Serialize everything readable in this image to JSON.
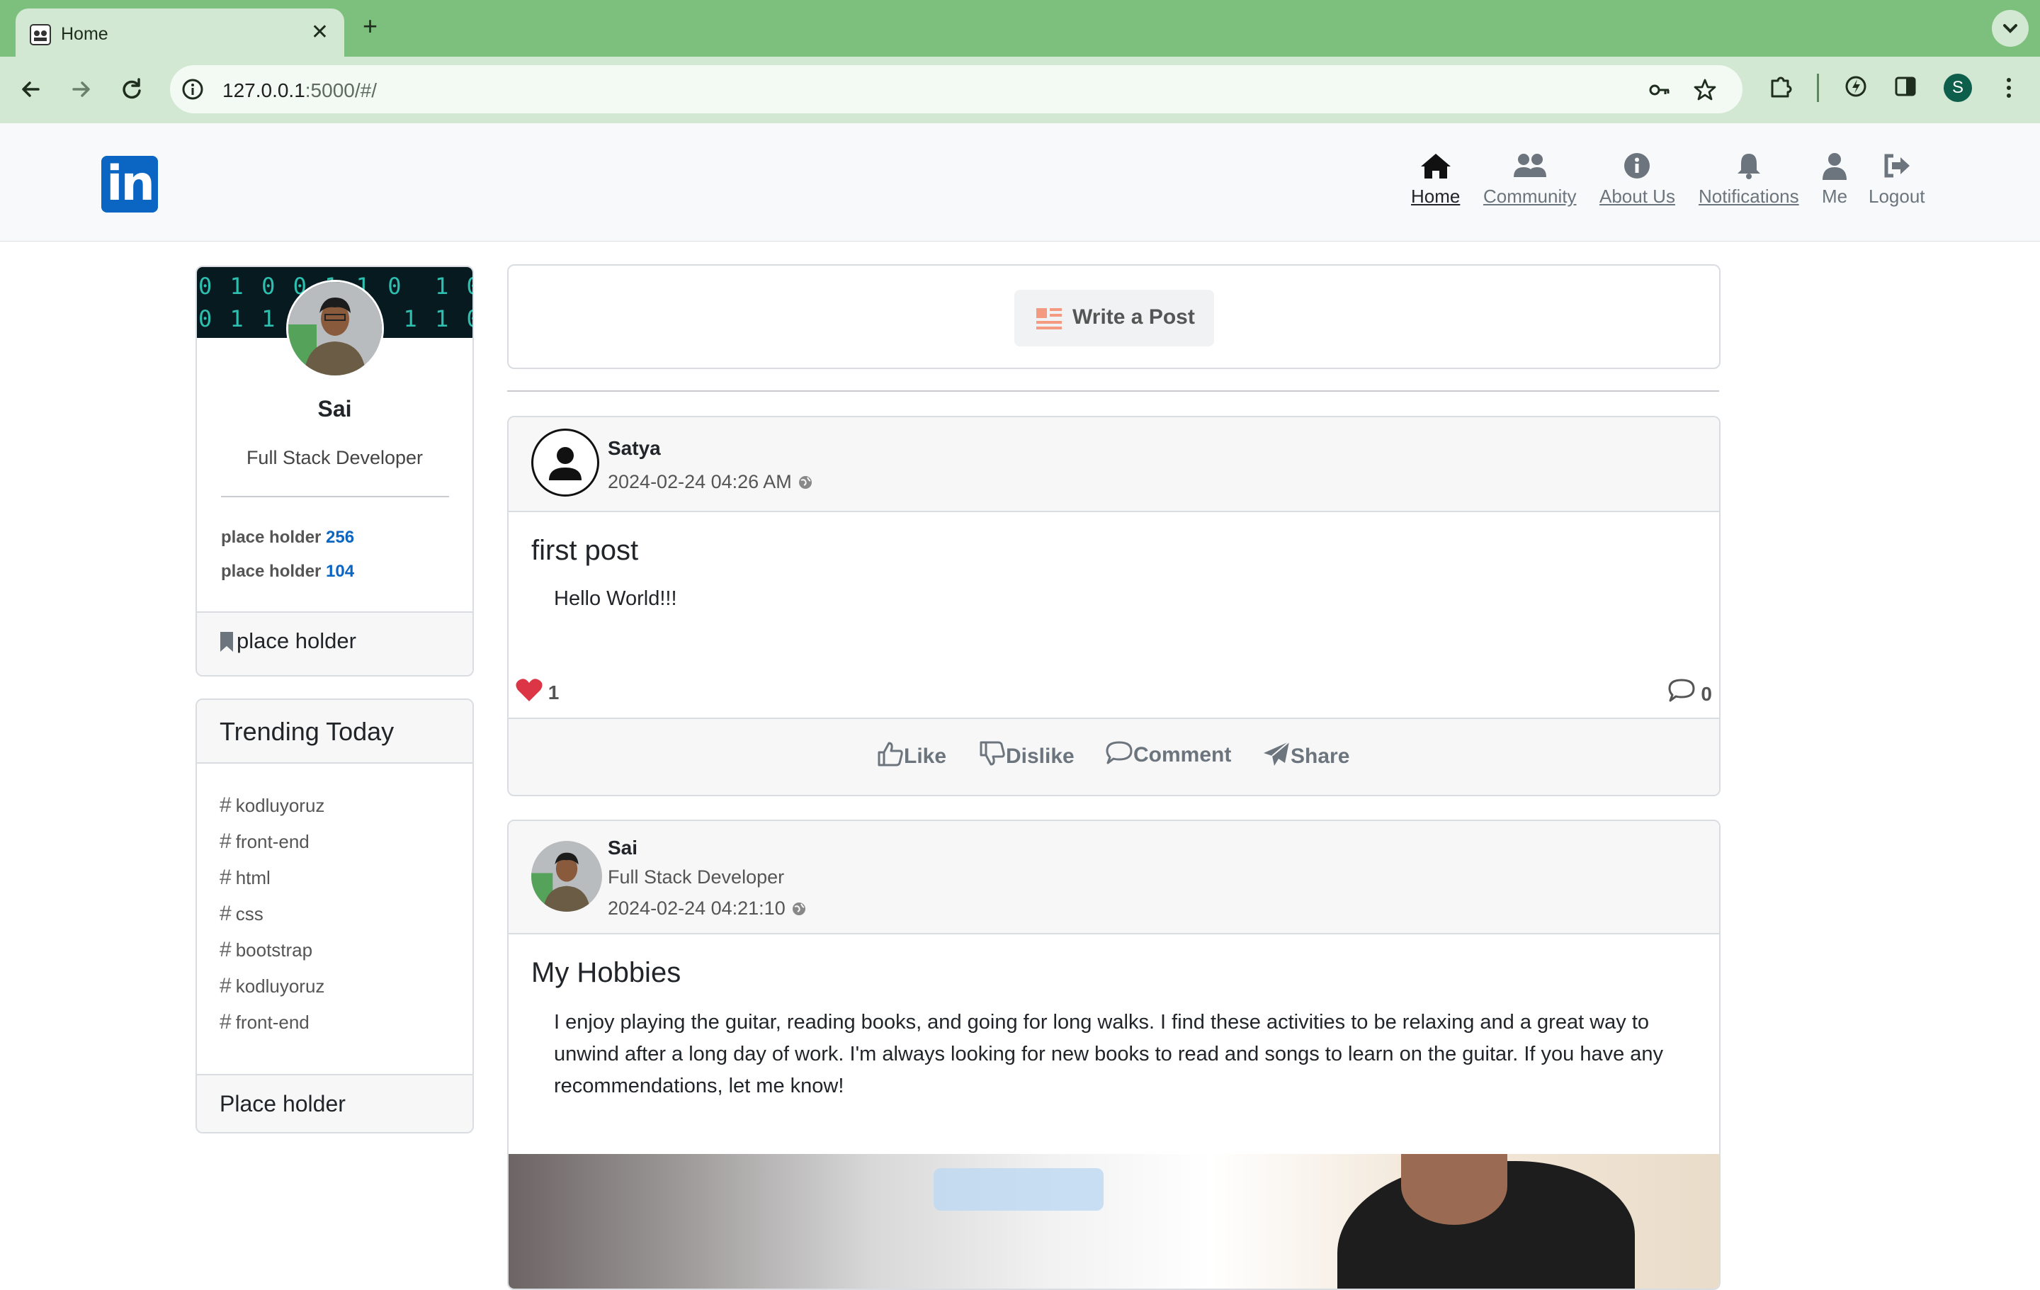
{
  "browser": {
    "tab_title": "Home",
    "url_host": "127.0.0.1",
    "url_rest": ":5000/#/",
    "profile_initial": "S"
  },
  "nav": {
    "items": [
      {
        "label": "Home",
        "icon": "home-icon"
      },
      {
        "label": "Community",
        "icon": "community-icon"
      },
      {
        "label": "About Us",
        "icon": "info-icon"
      },
      {
        "label": "Notifications",
        "icon": "bell-icon"
      },
      {
        "label": "Me",
        "icon": "user-icon"
      },
      {
        "label": "Logout",
        "icon": "logout-icon"
      }
    ],
    "logo_text": "in"
  },
  "profile": {
    "name": "Sai",
    "title": "Full Stack Developer",
    "stats": [
      {
        "label": "place holder",
        "value": "256"
      },
      {
        "label": "place holder",
        "value": "104"
      }
    ],
    "footer": "place holder"
  },
  "trending": {
    "title": "Trending Today",
    "tags": [
      "kodluyoruz",
      "front-end",
      "html",
      "css",
      "bootstrap",
      "kodluyoruz",
      "front-end"
    ],
    "footer": "Place holder"
  },
  "write_post": {
    "label": "Write a Post"
  },
  "posts": [
    {
      "author": "Satya",
      "subtitle": "",
      "time": "2024-02-24 04:26 AM",
      "title": "first post",
      "body": "Hello World!!!",
      "likes": "1",
      "comments": "0",
      "actions": [
        "Like",
        "Dislike",
        "Comment",
        "Share"
      ]
    },
    {
      "author": "Sai",
      "subtitle": "Full Stack Developer",
      "time": "2024-02-24 04:21:10",
      "title": "My Hobbies",
      "body": "I enjoy playing the guitar, reading books, and going for long walks. I find these activities to be relaxing and a great way to unwind after a long day of work. I'm always looking for new books to read and songs to learn on the guitar. If you have any recommendations, let me know!"
    }
  ],
  "colors": {
    "accent": "#0a66c2",
    "heart": "#dc3545",
    "chrome": "#7dbf7d"
  }
}
